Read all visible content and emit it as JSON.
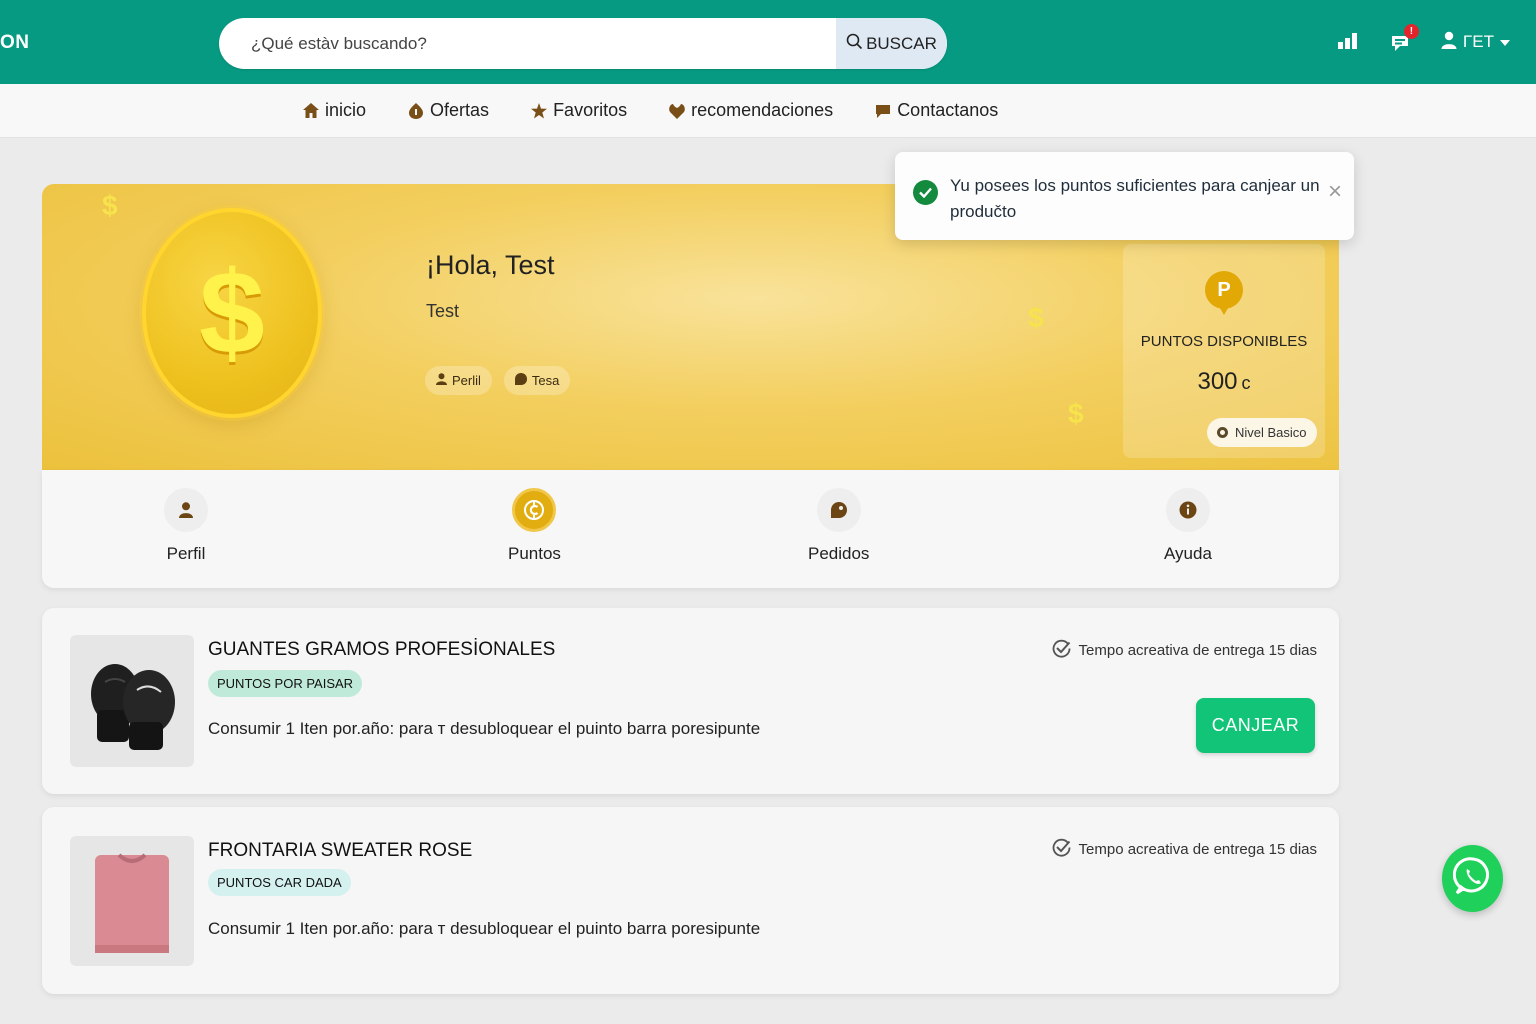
{
  "header": {
    "brand": "ON",
    "search_placeholder": "¿Qué estàv buscando?",
    "search_button": "BUSCAR",
    "notification_badge": "!",
    "user_label": "ΓET",
    "icons": [
      "stats-icon",
      "notification-icon",
      "user-icon",
      "caret-down-icon"
    ]
  },
  "nav": {
    "items": [
      {
        "label": "inicio",
        "icon": "home-icon"
      },
      {
        "label": "Ofertas",
        "icon": "offers-icon"
      },
      {
        "label": "Favoritos",
        "icon": "star-icon"
      },
      {
        "label": "recomendaciones",
        "icon": "recommend-icon"
      },
      {
        "label": "Contactanos",
        "icon": "contact-icon"
      }
    ]
  },
  "hero": {
    "greeting": "¡Hola, Test",
    "subtitle": "Test",
    "chips": [
      {
        "label": "Perlil",
        "icon": "user-icon"
      },
      {
        "label": "Tesa",
        "icon": "tag-icon"
      }
    ],
    "decor_symbol": "$",
    "points_badge": "P",
    "points_label": "PUNTOS DISPONIBLES",
    "points_value": "300",
    "points_unit": "c",
    "level": "Nivel Basico",
    "colors": {
      "accent": "#e1a806",
      "coin": "#f1c41f"
    }
  },
  "tabs": [
    {
      "label": "Perfil",
      "icon": "user-icon",
      "active": false
    },
    {
      "label": "Puntos",
      "icon": "coin-icon",
      "active": true
    },
    {
      "label": "Pedidos",
      "icon": "order-icon",
      "active": false
    },
    {
      "label": "Ayuda",
      "icon": "info-icon",
      "active": false
    }
  ],
  "products": [
    {
      "title": "GUANTES GRAMOS PROFESİONALES",
      "tag": "PUNTOS POR PAISAR",
      "tag_color": "#bfead9",
      "description": "Consumir 1 Iten por.año: para т desubloqueаr el puinto barra poresipunte",
      "delivery": "Tempo acreativa de entrega 15 dias",
      "button": "CANJEAR",
      "image": "boxing-gloves-image"
    },
    {
      "title": "FRONTARIA SWEATER ROSE",
      "tag": "PUNTOS CAR DADA",
      "tag_color": "#d4f0ef",
      "description": "Consumir 1 Iten por.año: para т desubloqueаr el puinto barra poresipunte",
      "delivery": "Tempo acreativa de entrega 15 dias",
      "button": "",
      "image": "pink-sweater-image"
    }
  ],
  "toast": {
    "message": "Yu posees los puntos suficientes para canjear un produčto",
    "close": "×"
  },
  "colors": {
    "brand_green": "#079a82",
    "button_green": "#12c477",
    "whatsapp": "#1fd05a"
  }
}
